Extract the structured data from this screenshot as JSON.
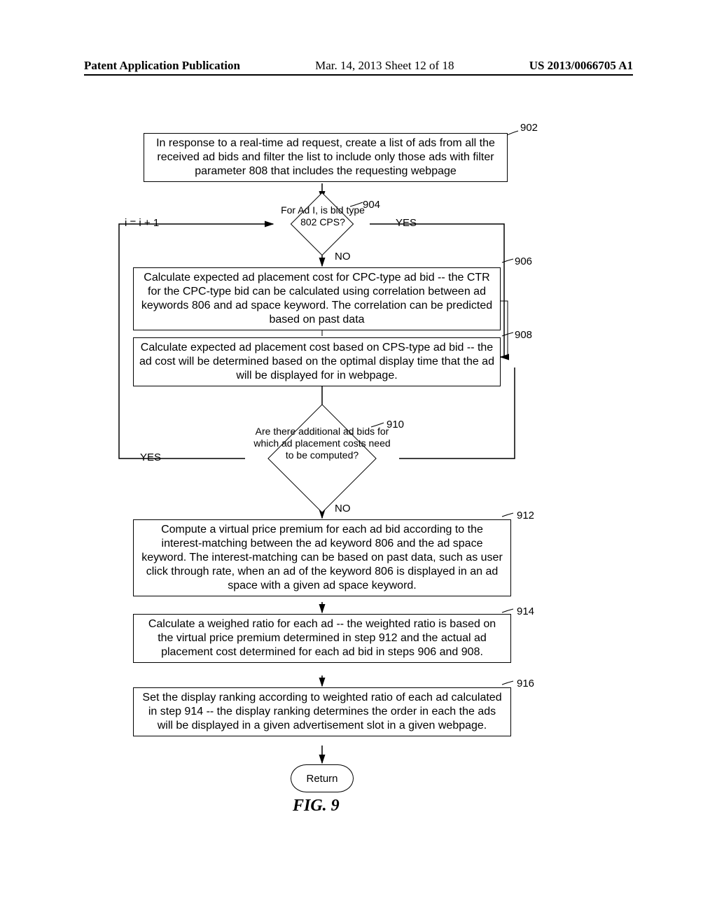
{
  "header": {
    "left": "Patent Application Publication",
    "center": "Mar. 14, 2013  Sheet 12 of 18",
    "right": "US 2013/0066705 A1"
  },
  "refs": {
    "r902": "902",
    "r904": "904",
    "r906": "906",
    "r908": "908",
    "r910": "910",
    "r912": "912",
    "r914": "914",
    "r916": "916"
  },
  "labels": {
    "yes_top": "YES",
    "no_top": "NO",
    "yes_mid": "YES",
    "no_mid": "NO",
    "increment": "i = i + 1",
    "return": "Return"
  },
  "steps": {
    "s902": "In response to a real-time ad request, create a list of ads from all the received ad bids and filter the list to include only those ads with filter parameter 808 that includes the requesting webpage",
    "d904": "For Ad I, is bid type 802 CPS?",
    "s906": "Calculate expected ad placement cost for CPC-type ad bid -- the CTR for the CPC-type bid can be calculated using correlation between ad keywords 806 and ad space keyword.  The correlation can be predicted based on past data",
    "s908": "Calculate expected ad placement cost based on CPS-type ad bid -- the ad cost will be determined based on the optimal display time that the ad will be displayed for in webpage.",
    "d910": "Are there additional ad bids for which ad placement costs need to be computed?",
    "s912": "Compute a virtual price premium for each ad bid according to the interest-matching between the ad keyword 806 and the ad space keyword.  The interest-matching can be based on past data, such as user click through rate, when an ad of the keyword 806 is displayed in an ad space with a given ad space keyword.",
    "s914": "Calculate a weighed ratio for each ad -- the weighted ratio is based on the virtual price premium determined in step 912 and the actual ad placement cost determined for each ad bid in steps 906 and 908.",
    "s916": "Set the display ranking according to weighted ratio of each ad calculated in step 914 -- the display ranking determines the order in each the ads will be displayed in a given advertisement slot in a given webpage."
  },
  "figure_caption": "FIG. 9",
  "chart_data": {
    "type": "table",
    "description": "Flowchart for computing ad display ranking from ad bids",
    "nodes": [
      {
        "id": "902",
        "type": "process",
        "text": "In response to a real-time ad request, create a list of ads from all the received ad bids and filter the list to include only those ads with filter parameter 808 that includes the requesting webpage"
      },
      {
        "id": "904",
        "type": "decision",
        "text": "For Ad I, is bid type 802 CPS?"
      },
      {
        "id": "906",
        "type": "process",
        "text": "Calculate expected ad placement cost for CPC-type ad bid -- the CTR for the CPC-type bid can be calculated using correlation between ad keywords 806 and ad space keyword. The correlation can be predicted based on past data"
      },
      {
        "id": "908",
        "type": "process",
        "text": "Calculate expected ad placement cost based on CPS-type ad bid -- the ad cost will be determined based on the optimal display time that the ad will be displayed for in webpage."
      },
      {
        "id": "910",
        "type": "decision",
        "text": "Are there additional ad bids for which ad placement costs need to be computed?"
      },
      {
        "id": "912",
        "type": "process",
        "text": "Compute a virtual price premium for each ad bid according to the interest-matching between the ad keyword 806 and the ad space keyword. The interest-matching can be based on past data, such as user click through rate, when an ad of the keyword 806 is displayed in an ad space with a given ad space keyword."
      },
      {
        "id": "914",
        "type": "process",
        "text": "Calculate a weighed ratio for each ad -- the weighted ratio is based on the virtual price premium determined in step 912 and the actual ad placement cost determined for each ad bid in steps 906 and 908."
      },
      {
        "id": "916",
        "type": "process",
        "text": "Set the display ranking according to weighted ratio of each ad calculated in step 914 -- the display ranking determines the order in each the ads will be displayed in a given advertisement slot in a given webpage."
      },
      {
        "id": "return",
        "type": "terminator",
        "text": "Return"
      }
    ],
    "edges": [
      {
        "from": "902",
        "to": "904"
      },
      {
        "from": "904",
        "to": "906",
        "label": "NO"
      },
      {
        "from": "904",
        "to": "908",
        "label": "YES"
      },
      {
        "from": "906",
        "to": "910"
      },
      {
        "from": "908",
        "to": "910"
      },
      {
        "from": "910",
        "to": "904",
        "label": "YES",
        "note": "i = i + 1"
      },
      {
        "from": "910",
        "to": "912",
        "label": "NO"
      },
      {
        "from": "912",
        "to": "914"
      },
      {
        "from": "914",
        "to": "916"
      },
      {
        "from": "916",
        "to": "return"
      }
    ]
  }
}
